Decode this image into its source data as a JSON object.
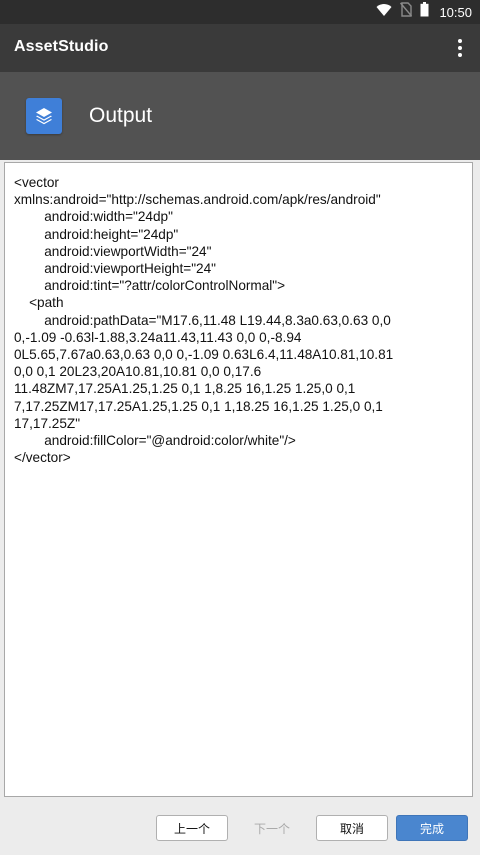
{
  "status_bar": {
    "time": "10:50",
    "icons": [
      "wifi-icon",
      "no-sim-icon",
      "battery-icon"
    ]
  },
  "app_bar": {
    "title": "AssetStudio",
    "overflow_icon": "more-vertical-icon"
  },
  "header": {
    "icon": "layers-icon",
    "title": "Output",
    "icon_color": "#3f7fd8"
  },
  "output": {
    "text": "<vector\nxmlns:android=\"http://schemas.android.com/apk/res/android\"\n        android:width=\"24dp\"\n        android:height=\"24dp\"\n        android:viewportWidth=\"24\"\n        android:viewportHeight=\"24\"\n        android:tint=\"?attr/colorControlNormal\">\n    <path\n        android:pathData=\"M17.6,11.48 L19.44,8.3a0.63,0.63 0,0\n0,-1.09 -0.63l-1.88,3.24a11.43,11.43 0,0 0,-8.94\n0L5.65,7.67a0.63,0.63 0,0 0,-1.09 0.63L6.4,11.48A10.81,10.81\n0,0 0,1 20L23,20A10.81,10.81 0,0 0,17.6\n11.48ZM7,17.25A1.25,1.25 0,1 1,8.25 16,1.25 1.25,0 0,1\n7,17.25ZM17,17.25A1.25,1.25 0,1 1,18.25 16,1.25 1.25,0 0,1\n17,17.25Z\"\n        android:fillColor=\"@android:color/white\"/>\n</vector>"
  },
  "buttons": {
    "previous": "上一个",
    "next": "下一个",
    "cancel": "取消",
    "finish": "完成"
  },
  "colors": {
    "primary_button": "#4a86cf",
    "app_bar": "#3a3a3a",
    "header": "#525252"
  }
}
